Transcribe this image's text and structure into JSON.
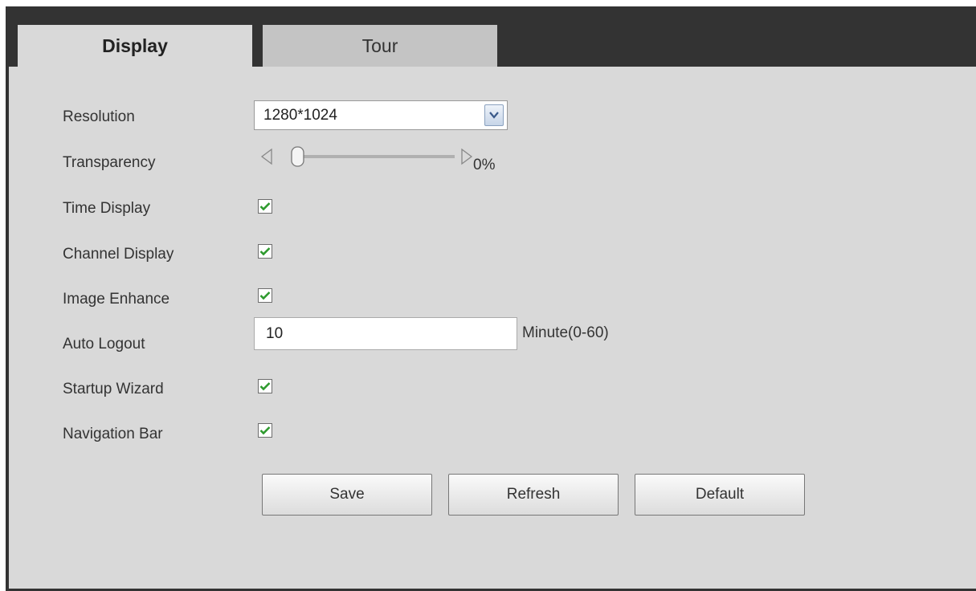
{
  "tabs": {
    "display": "Display",
    "tour": "Tour"
  },
  "fields": {
    "resolution": {
      "label": "Resolution",
      "value": "1280*1024"
    },
    "transparency": {
      "label": "Transparency",
      "value_text": "0%",
      "level": 0
    },
    "time_display": {
      "label": "Time Display",
      "checked": true
    },
    "channel_display": {
      "label": "Channel Display",
      "checked": true
    },
    "image_enhance": {
      "label": "Image Enhance",
      "checked": true
    },
    "auto_logout": {
      "label": "Auto Logout",
      "value": "10",
      "unit": "Minute(0-60)"
    },
    "startup_wizard": {
      "label": "Startup Wizard",
      "checked": true
    },
    "navigation_bar": {
      "label": "Navigation Bar",
      "checked": true
    }
  },
  "buttons": {
    "save": "Save",
    "refresh": "Refresh",
    "default": "Default"
  },
  "colors": {
    "check": "#2e9a2e",
    "tabbar": "#333333",
    "panel": "#d9d9d9"
  }
}
